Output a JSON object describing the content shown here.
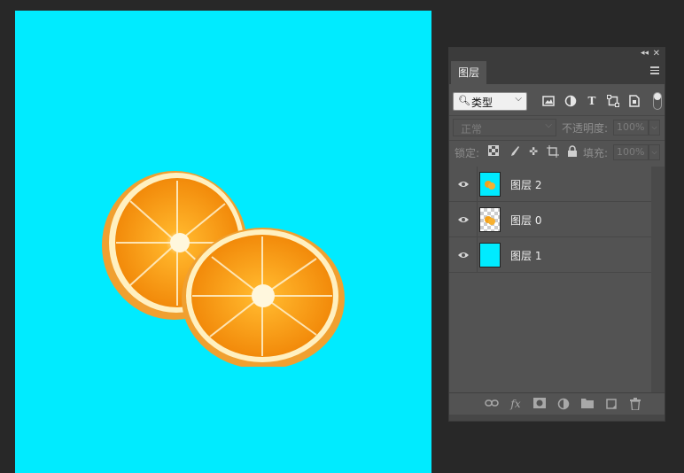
{
  "panel": {
    "collapse_glyph": "◂◂",
    "close_glyph": "✕",
    "tab_label": "图层",
    "filter": {
      "label": "类型",
      "icons": [
        "image-filter-icon",
        "adjustment-filter-icon",
        "type-filter-icon",
        "shape-filter-icon",
        "smart-object-filter-icon"
      ]
    },
    "blend_mode": "正常",
    "opacity_label": "不透明度:",
    "opacity_value": "100%",
    "lock_label": "锁定:",
    "fill_label": "填充:",
    "fill_value": "100%"
  },
  "layers": [
    {
      "name": "图层 2",
      "visible": true,
      "thumb": "cyan-with-orange"
    },
    {
      "name": "图层 0",
      "visible": true,
      "thumb": "transparent-with-orange"
    },
    {
      "name": "图层 1",
      "visible": true,
      "thumb": "cyan"
    }
  ],
  "colors": {
    "canvas": "#00ebff",
    "panel": "#535353",
    "workspace": "#282828"
  }
}
